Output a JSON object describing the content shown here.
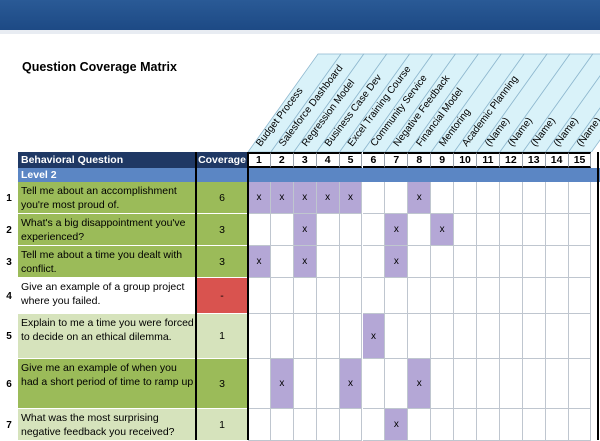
{
  "title": "Question Coverage Matrix",
  "headers": {
    "question": "Behavioral Question",
    "coverage": "Coverage",
    "projects": [
      "Budget Process",
      "Salesforce Dashboard",
      "Regression Model",
      "Business Case Dev",
      "Excel Training Course",
      "Community Service",
      "Negative Feedback",
      "Financial Model",
      "Mentoring",
      "Academic Planning",
      "(Name)",
      "(Name)",
      "(Name)",
      "(Name)",
      "(Name)"
    ],
    "numbers": [
      "1",
      "2",
      "3",
      "4",
      "5",
      "6",
      "7",
      "8",
      "9",
      "10",
      "11",
      "12",
      "13",
      "14",
      "15"
    ]
  },
  "level": "Level 2",
  "mark": "x",
  "colors": {
    "title_bar": "#1f4b87",
    "header_dark": "#1f3864",
    "level_band": "#5b86c4",
    "green_dark": "#9bbb59",
    "green_light": "#d6e3bc",
    "red": "#d9534f",
    "mark": "#b4a7d6",
    "header_stripe": "#d9f2f9"
  },
  "rows": [
    {
      "num": "1",
      "question": "Tell me about an accomplishment you're most proud of.",
      "coverage": "6",
      "marks": [
        1,
        2,
        3,
        4,
        5,
        8
      ],
      "color": "green_dark"
    },
    {
      "num": "2",
      "question": "What's a big disappointment you've experienced?",
      "coverage": "3",
      "marks": [
        3,
        7,
        9
      ],
      "color": "green_dark"
    },
    {
      "num": "3",
      "question": "Tell me about a time you dealt with conflict.",
      "coverage": "3",
      "marks": [
        1,
        3,
        7
      ],
      "color": "green_dark"
    },
    {
      "num": "4",
      "question": "Give an example of a group project where you failed.",
      "coverage": "-",
      "marks": [],
      "color": "red"
    },
    {
      "num": "5",
      "question": "Explain to me a time you were forced to decide on an ethical dilemma.",
      "coverage": "1",
      "marks": [
        6
      ],
      "color": "green_light"
    },
    {
      "num": "6",
      "question": "Give me an example of when you had a short period of time to ramp up",
      "coverage": "3",
      "marks": [
        2,
        5,
        8
      ],
      "color": "green_dark"
    },
    {
      "num": "7",
      "question": "What was the most surprising negative feedback you received?",
      "coverage": "1",
      "marks": [
        7
      ],
      "color": "green_light"
    }
  ]
}
